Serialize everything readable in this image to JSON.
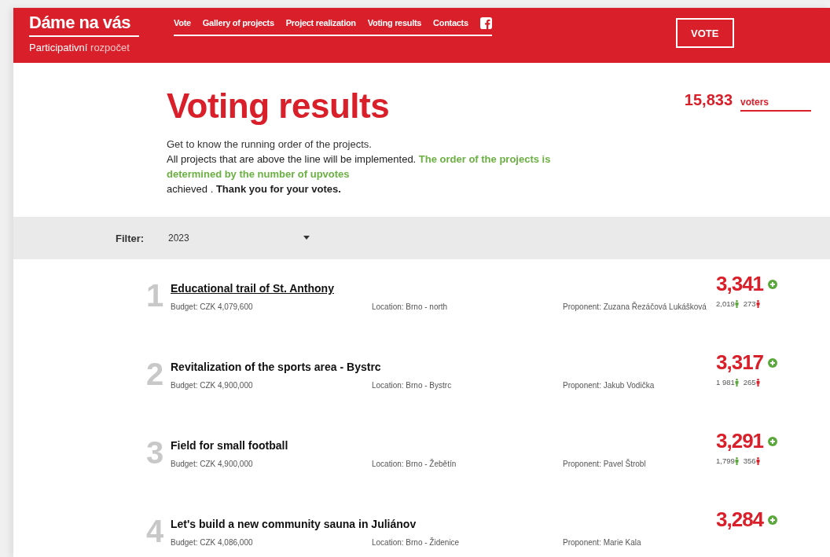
{
  "header": {
    "logo_title": "Dáme na vás",
    "logo_subtitle": [
      {
        "text": "Participativní",
        "kind": "strong"
      },
      {
        "text": "rozpočet",
        "kind": "light"
      }
    ],
    "nav": [
      "Vote",
      "Gallery of projects",
      "Project realization",
      "Voting results",
      "Contacts"
    ],
    "vote_button": "VOTE"
  },
  "title": "Voting results",
  "voters": {
    "count": "15,833",
    "label": "voters"
  },
  "intro_lead": "Get to know the running order of the projects.",
  "intro": [
    {
      "text": "All projects that are above the line will be implemented. ",
      "kind": "plain"
    },
    {
      "text": "The order of the projects is determined by the number of upvotes",
      "kind": "highlight"
    },
    {
      "text": "achieved . ",
      "kind": "plain"
    },
    {
      "text": "Thank you for your votes.",
      "kind": "bold"
    }
  ],
  "filter": {
    "label": "Filter:",
    "value": "2023"
  },
  "projects": [
    {
      "rank": "1",
      "name": "Educational trail of St. Anthony",
      "underlined": true,
      "budget": "Budget: CZK 4,079,600",
      "location": "Location: Brno - north",
      "proponent": "Proponent: Zuzana Řezáčová Lukášková",
      "votes": "3,341",
      "up": "2,019",
      "down": "273"
    },
    {
      "rank": "2",
      "name": "Revitalization of the sports area - Bystrc",
      "underlined": false,
      "budget": "Budget: CZK 4,900,000",
      "location": "Location: Brno - Bystrc",
      "proponent": "Proponent: Jakub Vodička",
      "votes": "3,317",
      "up": "1 981",
      "down": "265"
    },
    {
      "rank": "3",
      "name": "Field for small football",
      "underlined": false,
      "budget": "Budget: CZK 4,900,000",
      "location": "Location: Brno - Žebětín",
      "proponent": "Proponent: Pavel Štrobl",
      "votes": "3,291",
      "up": "1,799",
      "down": "356"
    },
    {
      "rank": "4",
      "name": "Let's build a new community sauna in Juliánov",
      "underlined": false,
      "budget": "Budget: CZK 4,086,000",
      "location": "Location: Brno - Židenice",
      "proponent": "Proponent: Marie Kala",
      "votes": "3,284"
    }
  ]
}
